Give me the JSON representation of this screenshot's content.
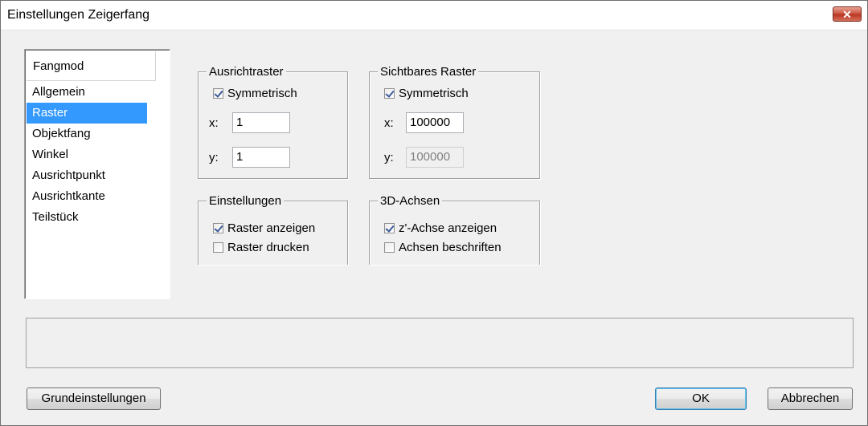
{
  "window": {
    "title": "Einstellungen Zeigerfang",
    "close_glyph": "✕"
  },
  "sidebar": {
    "header": "Fangmod",
    "items": [
      {
        "label": "Allgemein",
        "selected": false
      },
      {
        "label": "Raster",
        "selected": true
      },
      {
        "label": "Objektfang",
        "selected": false
      },
      {
        "label": "Winkel",
        "selected": false
      },
      {
        "label": "Ausrichtpunkt",
        "selected": false
      },
      {
        "label": "Ausrichtkante",
        "selected": false
      },
      {
        "label": "Teilstück",
        "selected": false
      }
    ]
  },
  "ausrichtraster": {
    "title": "Ausrichtraster",
    "symmetrisch": {
      "label": "Symmetrisch",
      "checked": true
    },
    "x_label": "x:",
    "x_value": "1",
    "y_label": "y:",
    "y_value": "1"
  },
  "sichtbare_raster": {
    "title": "Sichtbares Raster",
    "symmetrisch": {
      "label": "Symmetrisch",
      "checked": true
    },
    "x_label": "x:",
    "x_value": "100000",
    "y_label": "y:",
    "y_value": "100000"
  },
  "einstellungen": {
    "title": "Einstellungen",
    "raster_anzeigen": {
      "label": "Raster anzeigen",
      "checked": true
    },
    "raster_drucken": {
      "label": "Raster drucken",
      "checked": false
    }
  },
  "achsen3d": {
    "title": "3D-Achsen",
    "z_achse": {
      "label": "z'-Achse anzeigen",
      "checked": true
    },
    "beschriften": {
      "label": "Achsen beschriften",
      "checked": false
    }
  },
  "buttons": {
    "grundeinstellungen": "Grundeinstellungen",
    "ok": "OK",
    "abbrechen": "Abbrechen"
  },
  "colors": {
    "selection": "#3399ff",
    "close_button": "#c8513b",
    "dialog_bg": "#f0f0f0"
  }
}
